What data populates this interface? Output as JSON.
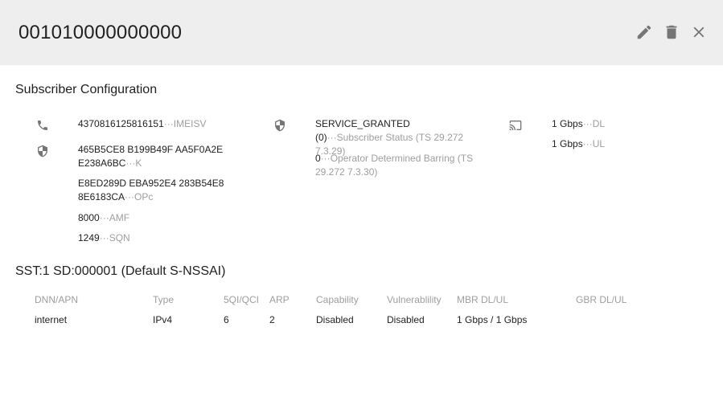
{
  "header": {
    "title": "001010000000000",
    "icons": {
      "edit": "pencil-icon",
      "delete": "trash-icon",
      "close": "close-icon"
    }
  },
  "config": {
    "title": "Subscriber Configuration",
    "col1": {
      "icons": [
        "phone-icon",
        "shield-icon"
      ],
      "imeisv": {
        "value": "4370816125816151",
        "label": "IMEISV"
      },
      "k": {
        "value": "465B5CE8 B199B49F AA5F0A2E E238A6BC",
        "label": "K"
      },
      "opc": {
        "value": "E8ED289D EBA952E4 283B54E8 8E6183CA",
        "label": "OPc"
      },
      "amf": {
        "value": "8000",
        "label": "AMF"
      },
      "sqn": {
        "value": "1249",
        "label": "SQN"
      }
    },
    "col2": {
      "icon": "shield-icon",
      "status": {
        "value": "SERVICE_GRANTED (0)",
        "label": "Subscriber Status (TS 29.272 7.3.29)"
      },
      "odb": {
        "value": "0",
        "label": "Operator Determined Barring (TS 29.272 7.3.30)"
      }
    },
    "col3": {
      "icon": "cast-icon",
      "dl": {
        "value": "1 Gbps",
        "label": "DL"
      },
      "ul": {
        "value": "1 Gbps",
        "label": "UL"
      }
    },
    "separator": "···"
  },
  "slice": {
    "title": "SST:1 SD:000001 (Default S-NSSAI)",
    "headers": [
      "DNN/APN",
      "Type",
      "5QI/QCI",
      "ARP",
      "Capability",
      "Vulnerablility",
      "MBR DL/UL",
      "GBR DL/UL"
    ],
    "rows": [
      [
        "internet",
        "IPv4",
        "6",
        "2",
        "Disabled",
        "Disabled",
        "1 Gbps / 1 Gbps",
        ""
      ]
    ]
  },
  "colors": {
    "header_bg": "#eeeeee",
    "text": "#212121",
    "muted": "#9e9e9e",
    "icon": "#757575"
  }
}
